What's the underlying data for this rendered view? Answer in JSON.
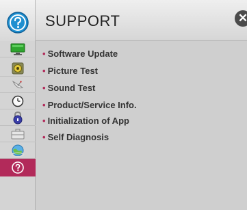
{
  "header": {
    "title": "SUPPORT",
    "icon": "question-mark-icon",
    "close_icon": "close-icon"
  },
  "sidebar": {
    "items": [
      {
        "name": "display-icon"
      },
      {
        "name": "speaker-icon"
      },
      {
        "name": "satellite-dish-icon"
      },
      {
        "name": "clock-icon"
      },
      {
        "name": "lock-icon"
      },
      {
        "name": "briefcase-icon"
      },
      {
        "name": "network-globe-icon"
      },
      {
        "name": "support-icon",
        "active": true
      }
    ]
  },
  "menu": {
    "bullet": "•",
    "items": [
      {
        "label": "Software Update"
      },
      {
        "label": "Picture Test"
      },
      {
        "label": "Sound Test"
      },
      {
        "label": "Product/Service Info."
      },
      {
        "label": "Initialization of App"
      },
      {
        "label": "Self Diagnosis"
      }
    ]
  },
  "colors": {
    "accent": "#b22a5a",
    "header_icon": "#1e8fd0",
    "background": "#cfcfcf"
  }
}
